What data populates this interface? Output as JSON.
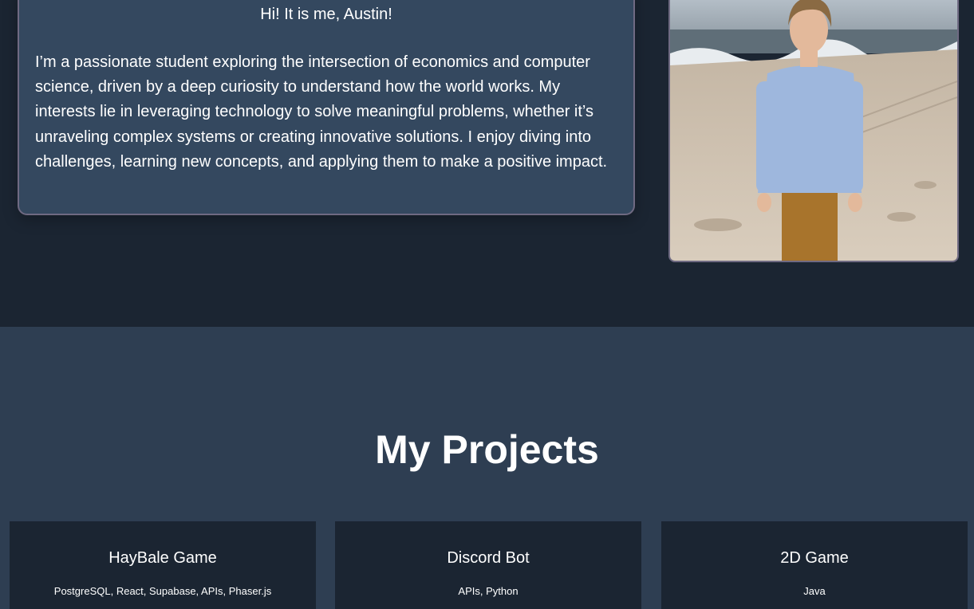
{
  "about": {
    "greeting": "Hi! It is me, Austin!",
    "bio": "I’m a passionate student exploring the intersection of economics and computer science, driven by a deep curiosity to understand how the world works. My interests lie in leveraging technology to solve meaningful problems, whether it’s unraveling complex systems or creating innovative solutions. I enjoy diving into challenges, learning new concepts, and applying them to make a positive impact."
  },
  "photo": {
    "subject": "person-standing-on-beach"
  },
  "projects": {
    "title": "My Projects",
    "items": [
      {
        "name": "HayBale Game",
        "tech": "PostgreSQL, React, Supabase, APIs, Phaser.js"
      },
      {
        "name": "Discord Bot",
        "tech": "APIs, Python"
      },
      {
        "name": "2D Game",
        "tech": "Java"
      }
    ]
  },
  "colors": {
    "page_bg": "#1b2532",
    "card_bg": "#34485f",
    "card_border": "#6f6a82",
    "projects_bg": "#2e3e52",
    "project_card_bg": "#1b2532"
  }
}
